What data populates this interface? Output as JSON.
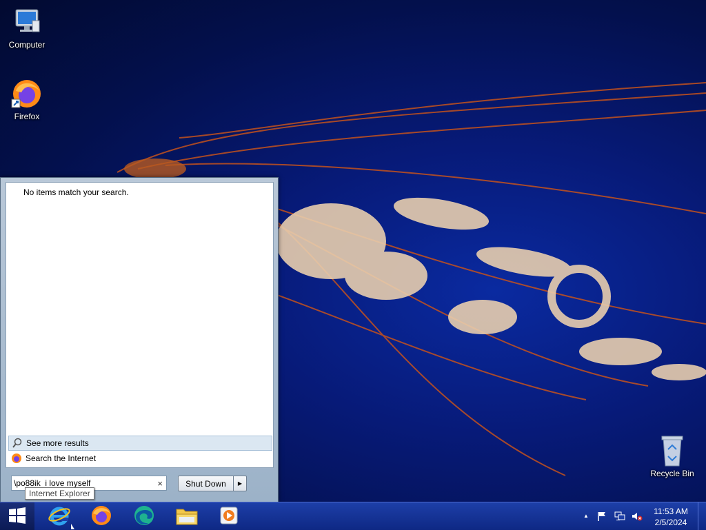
{
  "desktop": {
    "icons": [
      {
        "label": "Computer",
        "icon": "computer-icon"
      },
      {
        "label": "Firefox",
        "icon": "firefox-icon"
      },
      {
        "label": "Recycle Bin",
        "icon": "recycle-bin-icon"
      }
    ]
  },
  "start_menu": {
    "no_results_text": "No items match your search.",
    "see_more_label": "See more results",
    "search_internet_label": "Search the Internet",
    "search_value": "\\po88ik  i love myself",
    "search_clear": "×",
    "shutdown_label": "Shut Down",
    "shutdown_arrow": "▶"
  },
  "tooltip": {
    "text": "Internet Explorer"
  },
  "taskbar": {
    "start_icon": "windows-logo-icon",
    "pinned": [
      {
        "name": "Internet Explorer",
        "icon": "internet-explorer-icon"
      },
      {
        "name": "Firefox",
        "icon": "firefox-icon"
      },
      {
        "name": "Edge",
        "icon": "edge-icon"
      },
      {
        "name": "File Explorer",
        "icon": "file-explorer-icon"
      },
      {
        "name": "Media Player",
        "icon": "media-player-icon"
      }
    ],
    "tray": {
      "show_hidden": "▲",
      "time": "11:53 AM",
      "date": "2/5/2024"
    }
  },
  "colors": {
    "taskbar": "#1a3a9e",
    "desktop_bg": "#071a78",
    "start_menu_frame": "#a9bccf",
    "highlight_row": "#dbe7f2"
  }
}
